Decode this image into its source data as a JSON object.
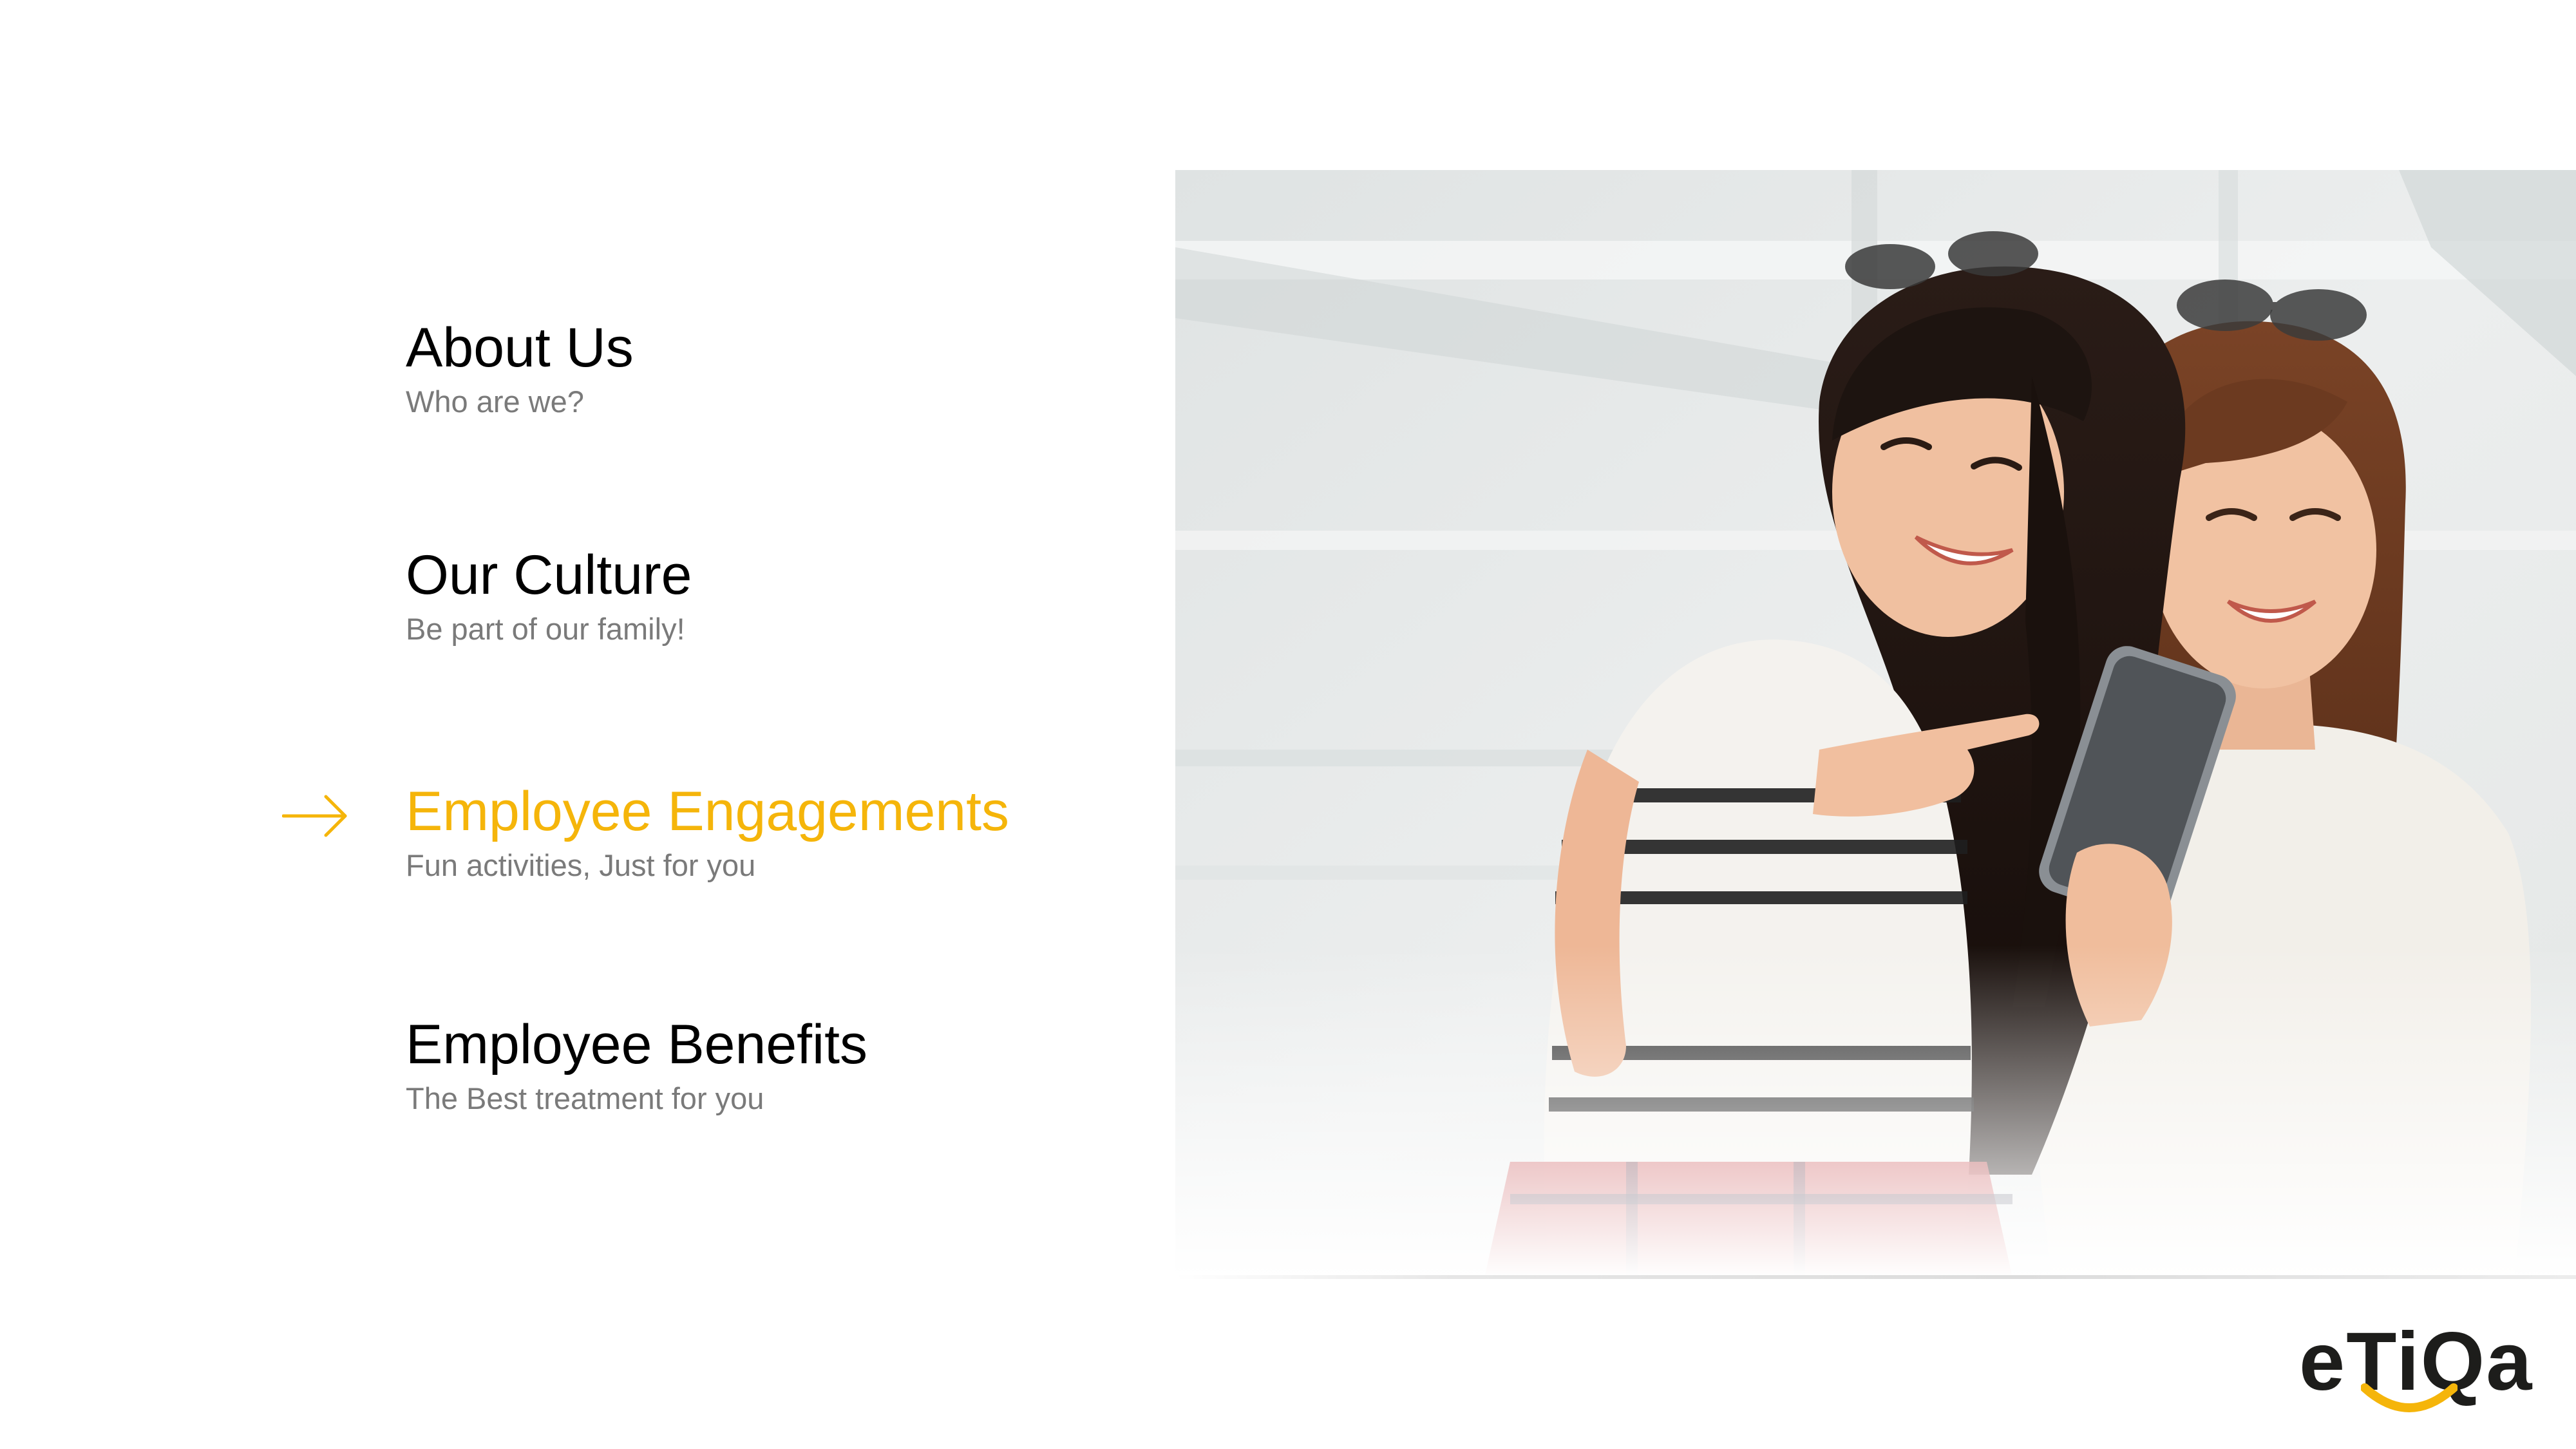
{
  "menu": {
    "items": [
      {
        "title": "About Us",
        "subtitle": "Who are we?"
      },
      {
        "title": "Our Culture",
        "subtitle": "Be part of our family!"
      },
      {
        "title": "Employee Engagements",
        "subtitle": "Fun activities, Just for you"
      },
      {
        "title": "Employee Benefits",
        "subtitle": "The Best treatment for you"
      }
    ],
    "active_index": 2,
    "active_color": "#f5b50a",
    "arrow_icon": "arrow-right-icon"
  },
  "photo": {
    "subject": "two-women-looking-at-smartphone"
  },
  "brand": {
    "logo_text": "eTiQa",
    "logo_color": "#1d1d1b",
    "accent_color": "#f5b50a"
  }
}
